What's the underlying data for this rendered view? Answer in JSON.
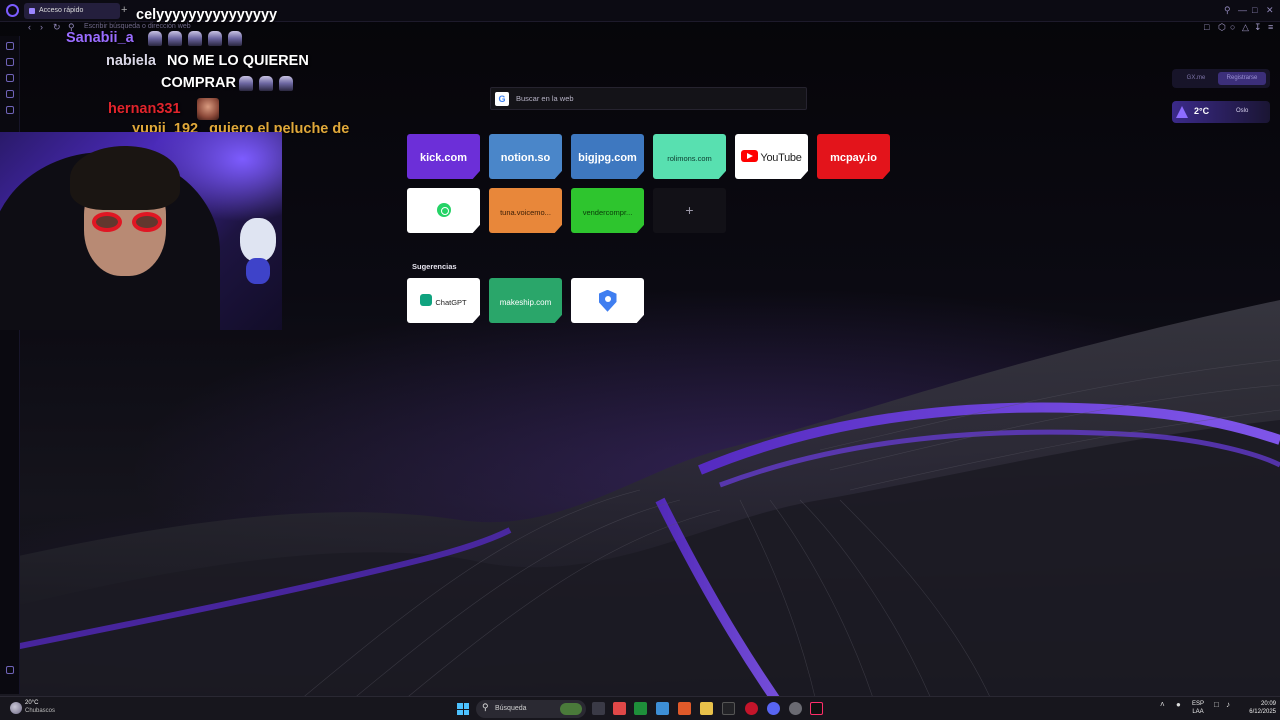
{
  "browser": {
    "tab_title": "Acceso rápido",
    "new_tab_symbol": "+",
    "address_placeholder": "Escribir búsqueda o dirección web"
  },
  "chat": {
    "messages": [
      {
        "user": "",
        "text": "celyyyyyyyyyyyyyyy",
        "user_color": "#ffffff"
      },
      {
        "user": "Sanabii_a",
        "text": "",
        "user_color": "#9a6cff"
      },
      {
        "user": "nabiela",
        "text": "NO ME LO QUIEREN",
        "user_color": "#d9d6e6"
      },
      {
        "user": "",
        "text": "COMPRAR",
        "user_color": "#ffffff"
      },
      {
        "user": "hernan331",
        "text": "",
        "user_color": "#e0242c"
      },
      {
        "user": "yupii_192",
        "text": "quiero el peluche de n",
        "user_color": "#e0a83a"
      }
    ]
  },
  "speed_dial": {
    "search_placeholder": "Buscar en la web",
    "search_engine_icon": "G",
    "add_symbol": "+",
    "tiles": [
      {
        "label": "kick.com",
        "bg": "#6c2fd8",
        "color": "#ffffff"
      },
      {
        "label": "notion.so",
        "bg": "#4a86c9",
        "color": "#ffffff"
      },
      {
        "label": "bigjpg.com",
        "bg": "#3e78c0",
        "color": "#ffffff"
      },
      {
        "label": "rolimons.com",
        "bg": "#58e0b0",
        "color": "#0d3a2e"
      },
      {
        "label": "YouTube",
        "bg": "#ffffff",
        "color": "#222222"
      },
      {
        "label": "mcpay.io",
        "bg": "#e3141b",
        "color": "#ffffff"
      },
      {
        "label": "",
        "bg": "#ffffff",
        "color": "#25d366"
      },
      {
        "label": "tuna.voicemo...",
        "bg": "#e8873a",
        "color": "#3a1d05"
      },
      {
        "label": "vendercompr...",
        "bg": "#2ec52e",
        "color": "#0a3a0a"
      }
    ],
    "suggestions_label": "Sugerencias",
    "suggestions": [
      {
        "label": "ChatGPT",
        "bg": "#ffffff",
        "color": "#222222"
      },
      {
        "label": "makeship.com",
        "bg": "#2aa66a",
        "color": "#ffffff"
      },
      {
        "label": "",
        "bg": "#ffffff",
        "color": "#3f7ef0"
      }
    ]
  },
  "widgets": {
    "gx_tab": "GX.me",
    "register_tab": "Registrarse",
    "weather_temp": "2°C",
    "weather_city": "Oslo"
  },
  "taskbar": {
    "temp": "20°C",
    "condition": "Chubascos",
    "search_placeholder": "Búsqueda",
    "lang_top": "ESP",
    "lang_bottom": "LAA",
    "time": "20:09",
    "date": "6/12/2025"
  }
}
